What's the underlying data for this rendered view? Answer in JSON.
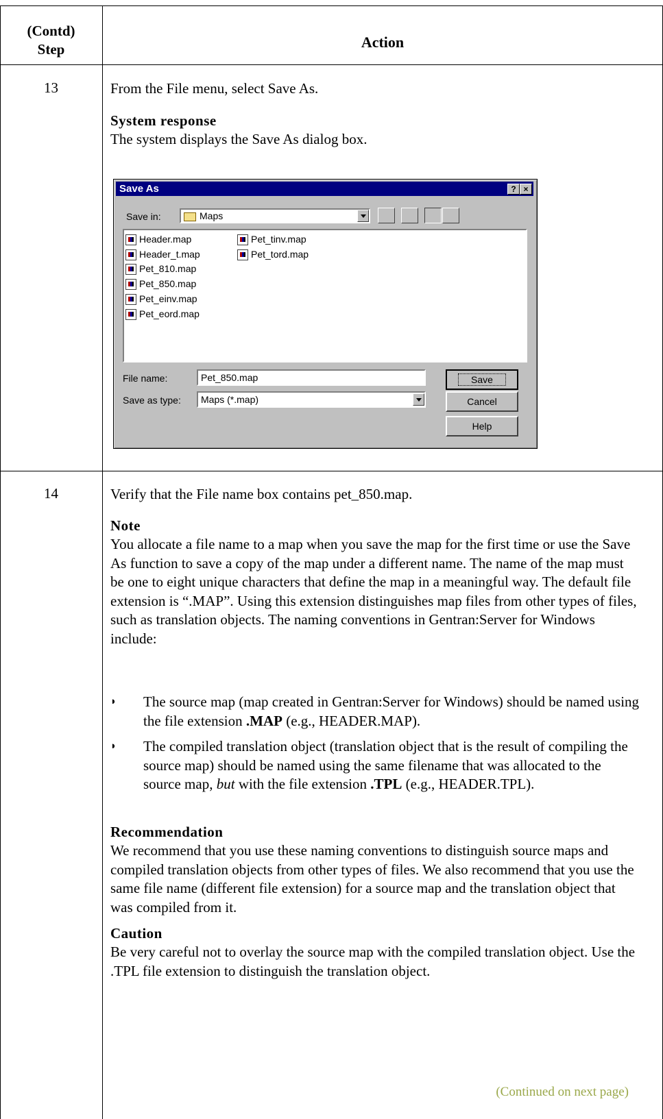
{
  "table": {
    "header": {
      "step_line1": "(Contd)",
      "step_line2": "Step",
      "action": "Action"
    }
  },
  "step13": {
    "number": "13",
    "instruction": "From the File menu, select Save As.",
    "response_heading": "System response",
    "response_text": "The system displays the Save As dialog box."
  },
  "dialog": {
    "title": "Save As",
    "help_btn": "?",
    "close_btn": "×",
    "save_in_label": "Save in:",
    "save_in_value": "Maps",
    "files": [
      "Header.map",
      "Header_t.map",
      "Pet_810.map",
      "Pet_850.map",
      "Pet_einv.map",
      "Pet_eord.map",
      "Pet_tinv.map",
      "Pet_tord.map"
    ],
    "file_name_label": "File name:",
    "file_name_value": "Pet_850.map",
    "save_type_label": "Save as type:",
    "save_type_value": "Maps (*.map)",
    "save_btn": "Save",
    "cancel_btn": "Cancel",
    "help_button": "Help"
  },
  "step14": {
    "number": "14",
    "instruction": "Verify that the File name box contains pet_850.map.",
    "note_heading": "Note",
    "note_text": "You allocate a file name to a map when you save the map for the first time or use the Save As function to save a copy of the map under a different name. The name of the map must be one to eight unique characters that define the map in a meaningful way. The default file extension is “.MAP”. Using this extension distinguishes map files from other types of files, such as translation objects. The naming conventions in Gentran:Server for Windows include:",
    "bullet1_pre": "The source map (map created in Gentran:Server for Windows) should be named using the file extension ",
    "bullet1_bold": ".MAP",
    "bullet1_post": " (e.g., HEADER.MAP).",
    "bullet2_pre": "The compiled translation object (translation object that is the result of compiling the source map) should be named using the same filename that was allocated to the source map, ",
    "bullet2_italic": "but",
    "bullet2_mid": " with the file extension ",
    "bullet2_bold": ".TPL",
    "bullet2_post": " (e.g., HEADER.TPL).",
    "rec_heading": "Recommendation",
    "rec_text": "We recommend that you use these naming conventions to distinguish source maps and compiled translation objects from other types of files. We also recommend that you use the same file name (different file extension) for a source map and the translation object that was compiled from it.",
    "caution_heading": "Caution",
    "caution_text": "Be very careful not to overlay the source map with the compiled translation object. Use the .TPL file extension to distinguish the translation object.",
    "continued": "(Continued on next page)"
  }
}
